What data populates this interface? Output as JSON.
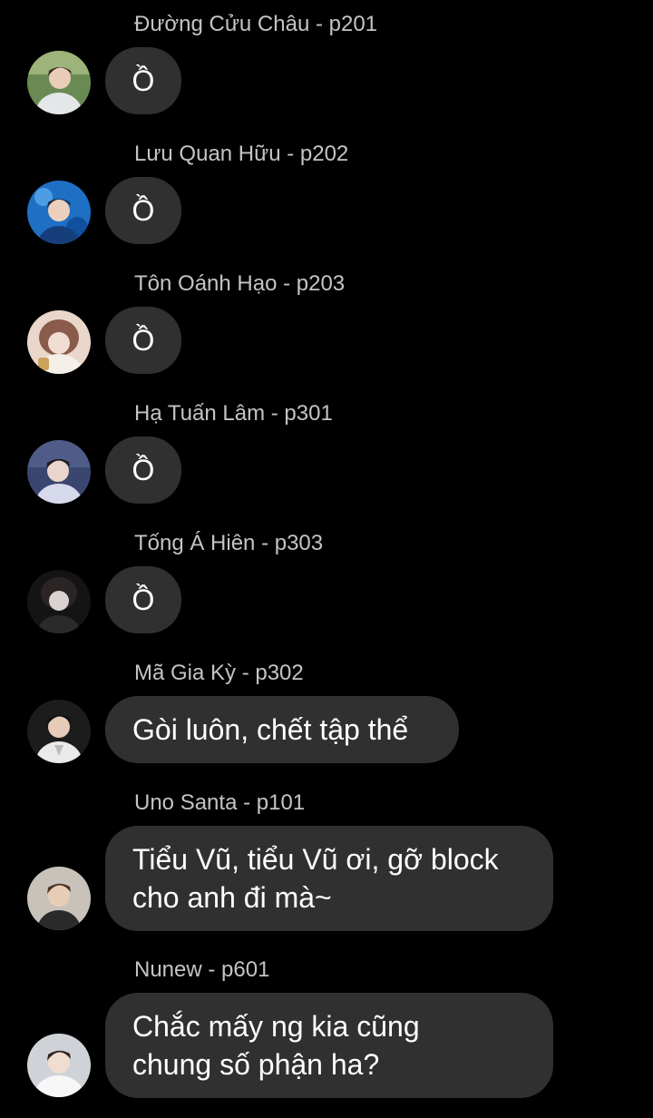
{
  "messages": [
    {
      "sender": "Đường Cửu Châu - p201",
      "text": "Ồ",
      "avatar_colors": [
        "#6a8a54",
        "#dfe3e6"
      ]
    },
    {
      "sender": "Lưu Quan Hữu - p202",
      "text": "Ồ",
      "avatar_colors": [
        "#1f6fc4",
        "#e8c8b4"
      ]
    },
    {
      "sender": "Tôn Oánh Hạo - p203",
      "text": "Ồ",
      "avatar_colors": [
        "#8a5a4a",
        "#f2ddd2"
      ]
    },
    {
      "sender": "Hạ Tuấn Lâm - p301",
      "text": "Ồ",
      "avatar_colors": [
        "#3a4670",
        "#d6d9ec"
      ]
    },
    {
      "sender": "Tống Á Hiên - p303",
      "text": "Ồ",
      "avatar_colors": [
        "#141414",
        "#d8d2d2"
      ]
    },
    {
      "sender": "Mã Gia Kỳ - p302",
      "text": "Gòi luôn, chết tập thể",
      "avatar_colors": [
        "#1c1c1c",
        "#eaeaea"
      ]
    },
    {
      "sender": "Uno Santa - p101",
      "text": "Tiểu Vũ, tiểu Vũ ơi, gỡ block\ncho anh đi mà~",
      "avatar_colors": [
        "#c9c2bb",
        "#2a2a2a"
      ]
    },
    {
      "sender": "Nunew - p601",
      "text": "Chắc mấy ng kia cũng\nchung số phận ha?",
      "avatar_colors": [
        "#cfd3d8",
        "#f7f7f7"
      ]
    }
  ],
  "colors": {
    "background": "#000000",
    "bubble": "#303030",
    "sender_text": "#c4c4c4",
    "message_text": "#ffffff"
  }
}
